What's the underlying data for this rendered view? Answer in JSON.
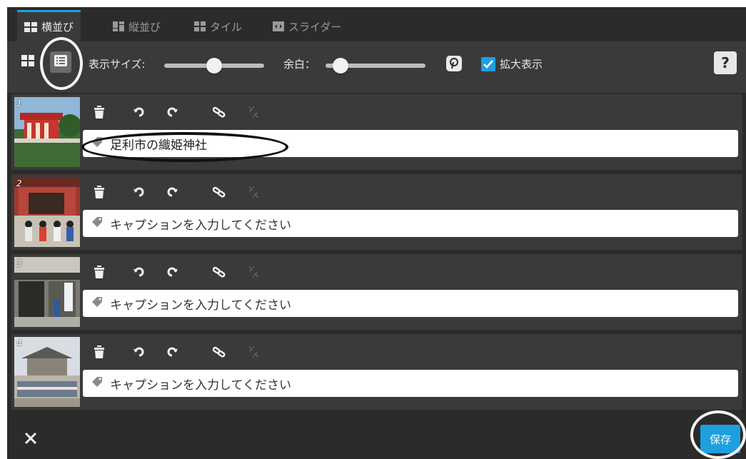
{
  "tabs": [
    {
      "label": "横並び",
      "icon": "horizontal-layout-icon",
      "active": true
    },
    {
      "label": "縦並び",
      "icon": "vertical-layout-icon",
      "active": false
    },
    {
      "label": "タイル",
      "icon": "tile-layout-icon",
      "active": false
    },
    {
      "label": "スライダー",
      "icon": "slider-layout-icon",
      "active": false
    }
  ],
  "toolbar": {
    "view_grid_icon": "grid-view-icon",
    "view_list_icon": "list-view-icon",
    "display_size_label": "表示サイズ:",
    "display_size_value": 0.5,
    "margin_label": "余白：",
    "margin_value": 0.15,
    "pinterest_icon": "pinterest-icon",
    "zoom_checked": true,
    "zoom_label": "拡大表示",
    "help_label": "?"
  },
  "rows": [
    {
      "number": "1",
      "caption": "足利市の織姫神社",
      "is_placeholder": false
    },
    {
      "number": "2",
      "caption": "キャプションを入力してください",
      "is_placeholder": true
    },
    {
      "number": "3",
      "caption": "キャプションを入力してください",
      "is_placeholder": true
    },
    {
      "number": "4",
      "caption": "キャプションを入力してください",
      "is_placeholder": true
    }
  ],
  "row_actions": [
    "trash-icon",
    "rotate-left-icon",
    "rotate-right-icon",
    "link-icon",
    "unlink-icon"
  ],
  "footer": {
    "close_icon": "close-icon",
    "save_label": "保存"
  },
  "colors": {
    "accent": "#1e9fe0",
    "background": "#2b2b2b",
    "panel": "#3a3a3a"
  }
}
